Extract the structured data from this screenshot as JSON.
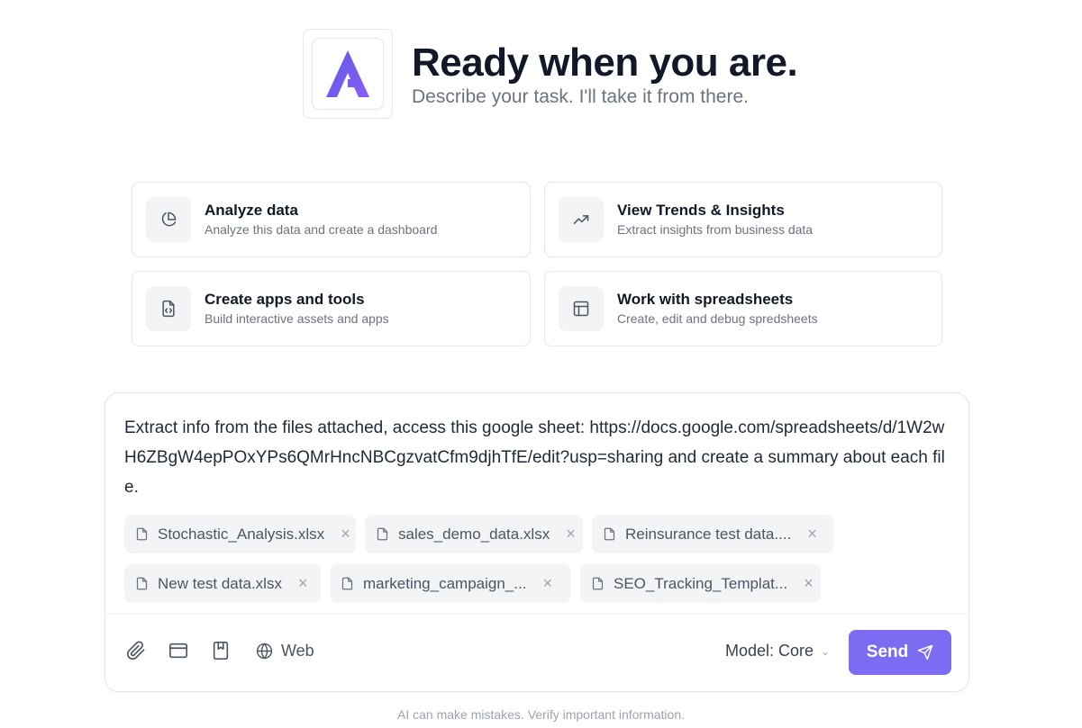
{
  "hero": {
    "title": "Ready when you are.",
    "subtitle": "Describe your task. I'll take it from there.",
    "logo_icon": "brand-logo-icon",
    "accent_color": "#6d5ce8"
  },
  "cards": [
    {
      "title": "Analyze data",
      "desc": "Analyze this data and create a dashboard",
      "icon": "pie-chart-icon"
    },
    {
      "title": "View Trends & Insights",
      "desc": "Extract insights from business data",
      "icon": "trending-up-icon"
    },
    {
      "title": "Create apps and tools",
      "desc": "Build interactive assets and apps",
      "icon": "code-file-icon"
    },
    {
      "title": "Work with spreadsheets",
      "desc": "Create, edit and debug spredsheets",
      "icon": "table-icon"
    }
  ],
  "composer": {
    "prompt": "Extract info from the files attached, access this google sheet: https://docs.google.com/spreadsheets/d/1W2wH6ZBgW4epPOxYPs6QMrHncNBCgzvatCfm9djhTfE/edit?usp=sharing and create a summary about each file.",
    "attachments": [
      {
        "name": "Stochastic_Analysis.xlsx"
      },
      {
        "name": "sales_demo_data.xlsx"
      },
      {
        "name": "Reinsurance test data...."
      },
      {
        "name": "New test data.xlsx"
      },
      {
        "name": "marketing_campaign_..."
      },
      {
        "name": "SEO_Tracking_Templat..."
      }
    ],
    "remove_glyph": "×",
    "toolbar": {
      "attach_icon": "paperclip-icon",
      "browser_icon": "browser-window-icon",
      "bookmark_icon": "bookmark-icon",
      "web_icon": "globe-icon",
      "web_label": "Web"
    },
    "model_label": "Model: Core",
    "model_chevron": "⌄",
    "send_label": "Send",
    "send_color": "#7c6cf2"
  },
  "disclaimer": "AI can make mistakes. Verify important information."
}
